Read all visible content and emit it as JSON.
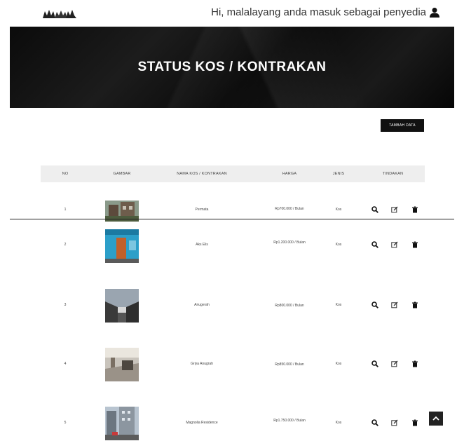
{
  "header": {
    "greeting": "Hi, malalayang anda masuk sebagai penyedia",
    "logo_icon": "logo-icon",
    "user_icon": "user-icon"
  },
  "banner": {
    "title": "STATUS KOS / KONTRAKAN"
  },
  "actions": {
    "add_label": "TAMBAH DATA"
  },
  "table": {
    "headers": [
      "NO",
      "GAMBAR",
      "NAMA KOS / KONTRAKAN",
      "HARGA",
      "JENIS",
      "TINDAKAN"
    ],
    "rows": [
      {
        "no": "1",
        "nama": "Permata",
        "harga": "Rp700.000 / Bulan",
        "jenis": "Kos"
      },
      {
        "no": "2",
        "nama": "Aks Elis",
        "harga": "Rp1.200.000 / Bulan",
        "jenis": "Kos"
      },
      {
        "no": "3",
        "nama": "Anugerah",
        "harga": "Rp800.000 / Bulan",
        "jenis": "Kos"
      },
      {
        "no": "4",
        "nama": "Griya Anugrah",
        "harga": "Rp850.000 / Bulan",
        "jenis": "Kos"
      },
      {
        "no": "5",
        "nama": "Magnolia Residence",
        "harga": "Rp1.750.000 / Bulan",
        "jenis": "Kos"
      }
    ]
  },
  "colors": {
    "banner_bg": "#111111",
    "header_bg": "#eeeeee",
    "button_bg": "#111111"
  }
}
